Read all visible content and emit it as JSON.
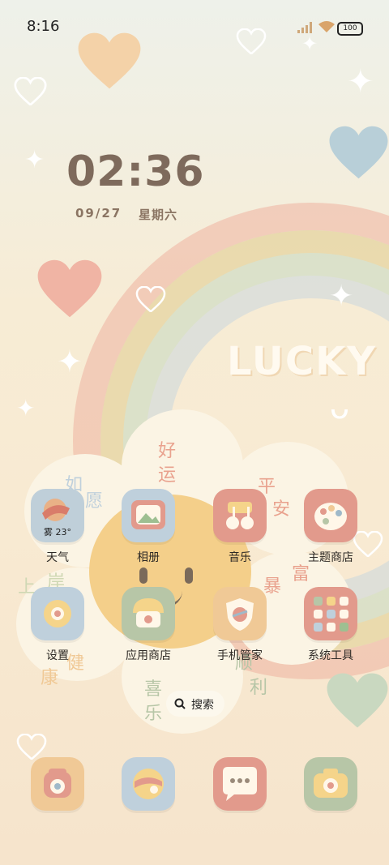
{
  "status_bar": {
    "time": "8:16",
    "battery_level": "100"
  },
  "clock": {
    "time": "02:36",
    "date": "09/27",
    "weekday": "星期六"
  },
  "wallpaper": {
    "lucky_text": "LUCKY",
    "flower_texts": [
      "好",
      "运",
      "平",
      "安",
      "暴",
      "富",
      "顺",
      "利",
      "喜",
      "乐",
      "上",
      "岸",
      "健",
      "康",
      "如",
      "愿"
    ]
  },
  "apps": [
    {
      "label": "天气",
      "icon": "weather-icon",
      "badge": "雾 23°",
      "color": "#bfcfd9"
    },
    {
      "label": "相册",
      "icon": "gallery-icon",
      "color": "#bfd0dc"
    },
    {
      "label": "音乐",
      "icon": "music-icon",
      "color": "#e29a8c"
    },
    {
      "label": "主题商店",
      "icon": "theme-store-icon",
      "color": "#e29a8c"
    },
    {
      "label": "设置",
      "icon": "settings-icon",
      "color": "#bfd0dc"
    },
    {
      "label": "应用商店",
      "icon": "app-store-icon",
      "color": "#b7c6a7"
    },
    {
      "label": "手机管家",
      "icon": "phone-manager-icon",
      "color": "#f0c996"
    },
    {
      "label": "系统工具",
      "icon": "system-tools-icon",
      "color": "#e29a8c"
    }
  ],
  "search": {
    "label": "搜索"
  },
  "dock": [
    {
      "icon": "phone-icon",
      "color": "#f0c996"
    },
    {
      "icon": "browser-icon",
      "color": "#bfd0dc"
    },
    {
      "icon": "messages-icon",
      "color": "#e29a8c"
    },
    {
      "icon": "camera-icon",
      "color": "#b7c6a7"
    }
  ]
}
